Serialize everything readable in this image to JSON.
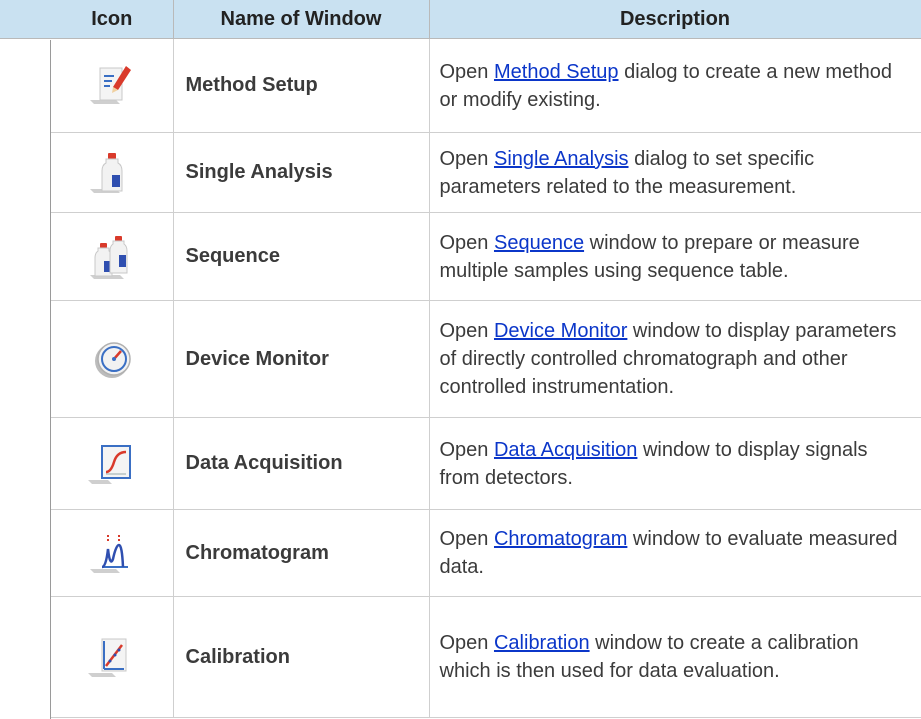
{
  "headers": {
    "icon": "Icon",
    "name": "Name of Window",
    "description": "Description"
  },
  "rows": [
    {
      "icon": "method-setup-icon",
      "name": "Method Setup",
      "desc_before": "Open ",
      "link": "Method Setup",
      "desc_after": " dialog to create a new method or modify existing."
    },
    {
      "icon": "single-analysis-icon",
      "name": "Single Analysis",
      "desc_before": "Open ",
      "link": "Single Analysis",
      "desc_after": " dialog to set specific parameters related to the measurement."
    },
    {
      "icon": "sequence-icon",
      "name": "Sequence",
      "desc_before": "Open ",
      "link": "Sequence",
      "desc_after": " window to prepare or measure multiple samples using sequence table."
    },
    {
      "icon": "device-monitor-icon",
      "name": "Device Monitor",
      "desc_before": "Open ",
      "link": "Device Monitor",
      "desc_after": " window to display parameters of directly controlled chromatograph and other controlled instrumentation."
    },
    {
      "icon": "data-acquisition-icon",
      "name": "Data Acquisition",
      "desc_before": "Open ",
      "link": "Data Acquisition",
      "desc_after": " window to display signals from detectors."
    },
    {
      "icon": "chromatogram-icon",
      "name": "Chromatogram",
      "desc_before": "Open ",
      "link": "Chromatogram",
      "desc_after": " window to evaluate measured data."
    },
    {
      "icon": "calibration-icon",
      "name": "Calibration",
      "desc_before": "Open ",
      "link": "Calibration",
      "desc_after": " window to create a calibration which is then used for data evaluation."
    }
  ],
  "colors": {
    "header_bg": "#c9e1f1",
    "link": "#0b36c9",
    "text": "#3b3b3b"
  }
}
